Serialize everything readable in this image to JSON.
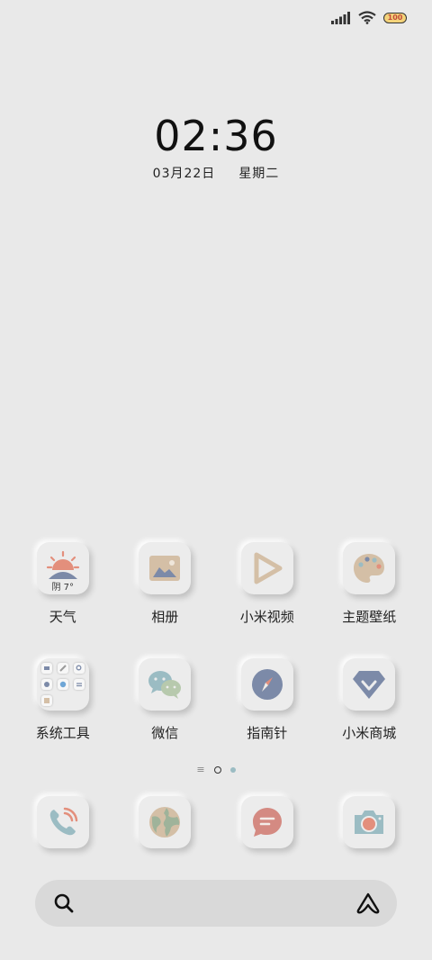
{
  "status_bar": {
    "battery_level": "100"
  },
  "clock": {
    "time": "02:36",
    "date": "03月22日",
    "weekday": "星期二"
  },
  "apps": [
    {
      "id": "weather",
      "label": "天气",
      "icon": "weather-icon",
      "badge": "阴 7°"
    },
    {
      "id": "gallery",
      "label": "相册",
      "icon": "gallery-icon"
    },
    {
      "id": "mi-video",
      "label": "小米视频",
      "icon": "video-play-icon"
    },
    {
      "id": "themes",
      "label": "主题壁纸",
      "icon": "palette-icon"
    },
    {
      "id": "tools",
      "label": "系统工具",
      "icon": "tools-folder-icon"
    },
    {
      "id": "wechat",
      "label": "微信",
      "icon": "wechat-icon"
    },
    {
      "id": "compass",
      "label": "指南针",
      "icon": "compass-icon"
    },
    {
      "id": "mi-store",
      "label": "小米商城",
      "icon": "mi-store-icon"
    }
  ],
  "dock": [
    {
      "id": "phone",
      "icon": "phone-icon"
    },
    {
      "id": "browser",
      "icon": "browser-globe-icon"
    },
    {
      "id": "messages",
      "icon": "message-icon"
    },
    {
      "id": "camera",
      "icon": "camera-icon"
    }
  ],
  "pager": {
    "active_index": 0,
    "page_count": 2
  },
  "search": {
    "left_icon": "search-icon",
    "right_icon": "assistant-icon"
  },
  "colors": {
    "background": "#e9e9e9",
    "accent_salmon": "#e38f7c",
    "accent_slate": "#7c8aa8",
    "accent_teal": "#9bbcc3",
    "accent_sand": "#d4bfa6"
  }
}
